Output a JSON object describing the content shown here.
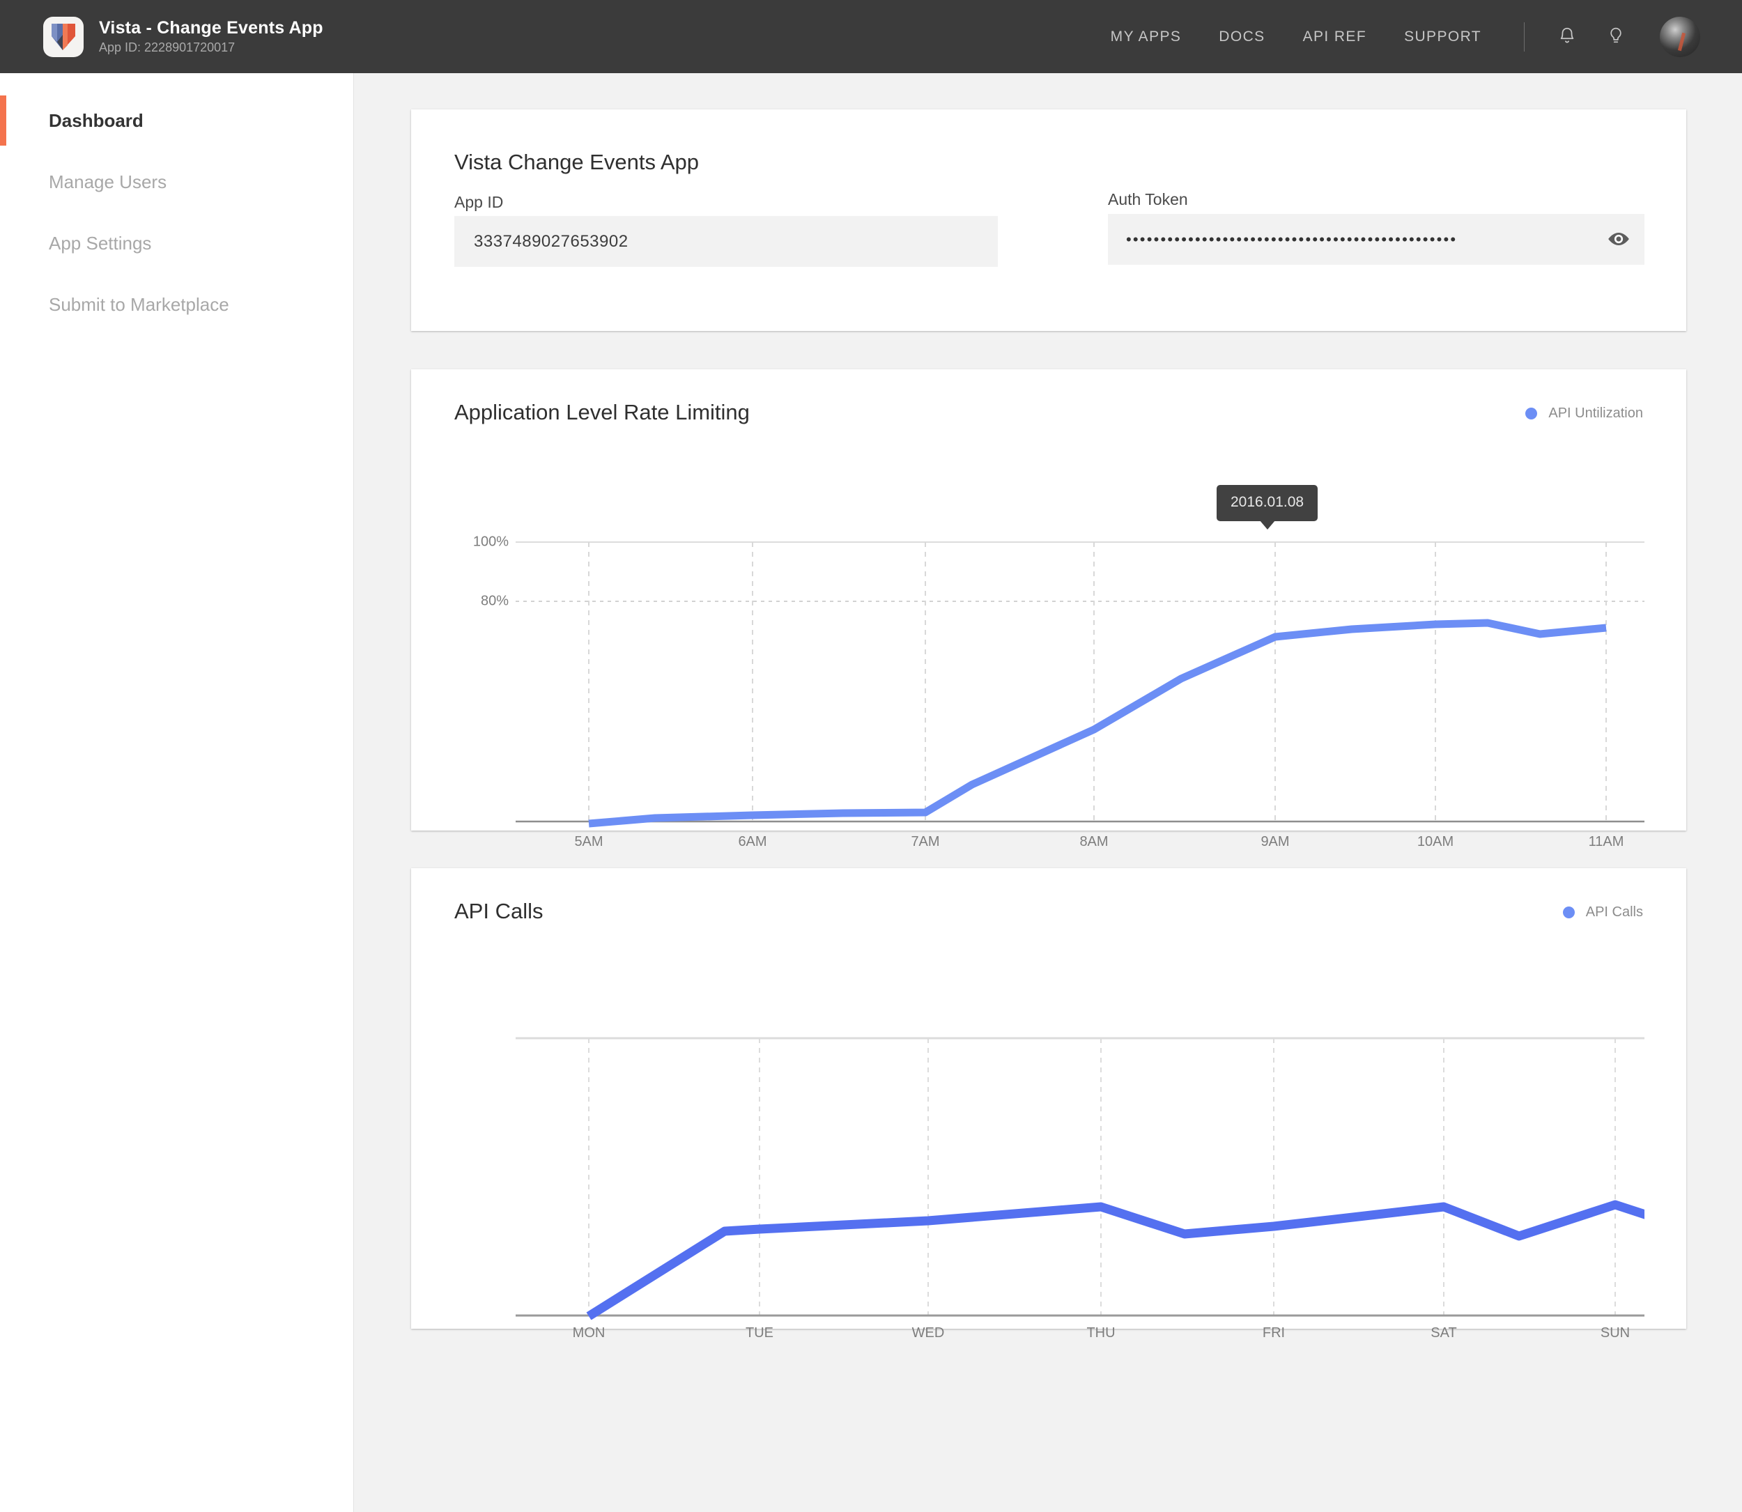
{
  "topbar": {
    "logo_icon": "vista-gem-logo-icon",
    "app_title": "Vista - Change Events App",
    "app_id_line": "App ID: 2228901720017",
    "nav": [
      {
        "label": "MY APPS"
      },
      {
        "label": "DOCS"
      },
      {
        "label": "API REF"
      },
      {
        "label": "SUPPORT"
      }
    ],
    "icons": [
      {
        "name": "notification-bell-icon"
      },
      {
        "name": "lightbulb-icon"
      }
    ],
    "avatar": "user-avatar"
  },
  "sidebar": {
    "items": [
      {
        "label": "Dashboard",
        "active": true
      },
      {
        "label": "Manage Users",
        "active": false
      },
      {
        "label": "App Settings",
        "active": false
      },
      {
        "label": "Submit to Marketplace",
        "active": false
      }
    ]
  },
  "app_card": {
    "title": "Vista Change Events App",
    "app_id_label": "App ID",
    "app_id_value": "3337489027653902",
    "auth_token_label": "Auth Token",
    "auth_token_masked": "••••••••••••••••••••••••••••••••••••••••••••••••",
    "reveal_icon": "eye-icon"
  },
  "rate_card": {
    "title": "Application Level Rate Limiting",
    "legend_label": "API Untilization",
    "tooltip": "2016.01.08"
  },
  "calls_card": {
    "title": "API Calls",
    "legend_label": "API Calls"
  },
  "colors": {
    "accent": "#f4734d",
    "series": "#6c8ef5",
    "topbar": "#3b3b3b",
    "page_bg": "#f2f2f2",
    "tooltip_bg": "#414141"
  },
  "chart_data": [
    {
      "type": "line",
      "title": "Application Level Rate Limiting",
      "xlabel": "",
      "ylabel": "",
      "grid": true,
      "legend_position": "top-right",
      "legend": [
        "API Untilization"
      ],
      "annotations": [
        {
          "text": "2016.01.08",
          "x": "9AM",
          "y": 70
        }
      ],
      "categories": [
        "5AM",
        "6AM",
        "7AM",
        "8AM",
        "9AM",
        "10AM",
        "11AM"
      ],
      "tick_labels": [
        "5AM",
        "6AM",
        "7AM",
        "8AM",
        "9AM",
        "10AM",
        "11AM"
      ],
      "ytick_labels": [
        "80%",
        "100%"
      ],
      "yticks": [
        80,
        100
      ],
      "ylim": [
        0,
        126
      ],
      "x": [
        5,
        5.6,
        6.2,
        6.85,
        7.0,
        7.5,
        8.0,
        8.5,
        9.0,
        9.5,
        10.0,
        10.5,
        10.7,
        11.0
      ],
      "series": [
        {
          "name": "API Untilization",
          "values": [
            1.0,
            1.8,
            2.4,
            3.2,
            3.4,
            16.0,
            28.0,
            46.0,
            67.0,
            70.5,
            73.5,
            74.0,
            71.0,
            72.5
          ]
        }
      ]
    },
    {
      "type": "line",
      "title": "API Calls",
      "xlabel": "",
      "ylabel": "",
      "grid": true,
      "legend_position": "top-right",
      "legend": [
        "API Calls"
      ],
      "categories": [
        "MON",
        "TUE",
        "WED",
        "THU",
        "FRI",
        "SAT",
        "SUN"
      ],
      "tick_labels": [
        "MON",
        "TUE",
        "WED",
        "THU",
        "FRI",
        "SAT",
        "SUN"
      ],
      "ytick_labels": [],
      "ylim": [
        0,
        100
      ],
      "x": [
        1.0,
        1.8,
        2.0,
        3.0,
        4.0,
        4.6,
        5.0,
        6.0,
        6.5,
        7.0,
        7.4
      ],
      "series": [
        {
          "name": "API Calls",
          "values": [
            0,
            30.5,
            31.0,
            36.0,
            41.5,
            30.5,
            34.5,
            41.5,
            28.5,
            42.5,
            31.0
          ]
        }
      ]
    }
  ]
}
